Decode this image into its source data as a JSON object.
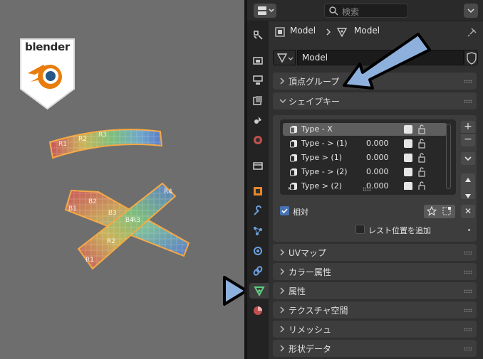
{
  "viewport": {
    "logo_text": "blender",
    "mesh_labels": [
      "R1",
      "R2",
      "R3",
      "B1",
      "B2",
      "B3",
      "B4",
      "R1",
      "R2",
      "R3",
      "R4"
    ]
  },
  "header": {
    "search_placeholder": "検索"
  },
  "breadcrumb": {
    "object": "Model",
    "mesh": "Model"
  },
  "datablock": {
    "name": "Model"
  },
  "sections": {
    "vertex_groups": "頂点グループ",
    "shape_keys": "シェイプキー",
    "uv_maps": "UVマップ",
    "color_attributes": "カラー属性",
    "attributes": "属性",
    "texture_space": "テクスチャ空間",
    "remesh": "リメッシュ",
    "shape_data": "形状データ"
  },
  "shape_keys": [
    {
      "name": "Type - X",
      "value": ""
    },
    {
      "name": "Type - > (1)",
      "value": "0.000"
    },
    {
      "name": "Type > (1)",
      "value": "0.000"
    },
    {
      "name": "Type - > (2)",
      "value": "0.000"
    },
    {
      "name": "Type > (2)",
      "value": "0.000"
    }
  ],
  "shape_key_buttons": {
    "add": "+",
    "remove": "−"
  },
  "relative": {
    "label": "相対",
    "checked": true
  },
  "rest_position": {
    "label": "レスト位置を追加",
    "checked": false
  },
  "colors": {
    "accent_blue": "#4772b3",
    "annotation_arrow": "#8eb0dd",
    "mesh_outline": "#f5a742",
    "blender_orange": "#e87d0d",
    "blender_blue": "#265787"
  }
}
